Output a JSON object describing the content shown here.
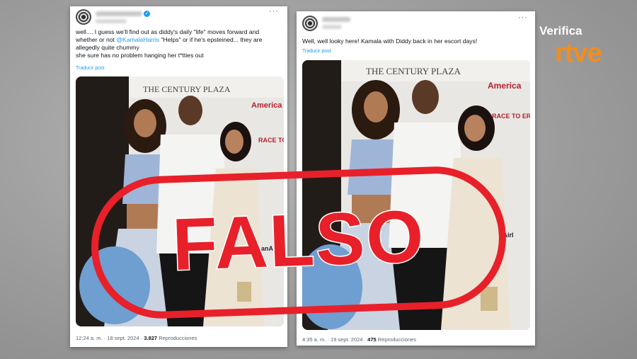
{
  "logo": {
    "verifica": "Verifica",
    "brand": "rtve"
  },
  "stamp": {
    "text": "FALSO"
  },
  "left_post": {
    "text_parts": [
      "well.... I guess we'll find out as diddy's daily \"life\" moves forward and whether or not ",
      "@KamalaHarris",
      " \"Helps\" or if he's epsteined... they are allegedly quite chummy",
      "she sure has no problem hanging her t*tties out"
    ],
    "translate": "Traducir post",
    "photo_banner": "THE CENTURY PLAZA",
    "photo_sign": "America",
    "photo_sign2": "RACE TO ERASE MS",
    "photo_sign3": "anAirl",
    "time": "12:24 a. m. · 18 sept. 2024 ·",
    "views_count": "3.827",
    "views_label": "Reproducciones"
  },
  "right_post": {
    "text": "Well, well looky here! Kamala with Diddy back in her escort days!",
    "translate": "Traducir post",
    "photo_banner": "THE CENTURY PLAZA",
    "photo_sign": "America",
    "photo_sign2": "RACE TO ERASE MS",
    "photo_sign3": "sanAirl",
    "time": "4:35 a. m. · 19 sept. 2024 ·",
    "views_count": "475",
    "views_label": "Reproducciones"
  },
  "colors": {
    "stamp": "#e8202a",
    "link": "#1d9bf0",
    "brand": "#f28d1f"
  },
  "icons": [
    "avatar-icon",
    "verified-badge-icon",
    "more-options-icon"
  ]
}
